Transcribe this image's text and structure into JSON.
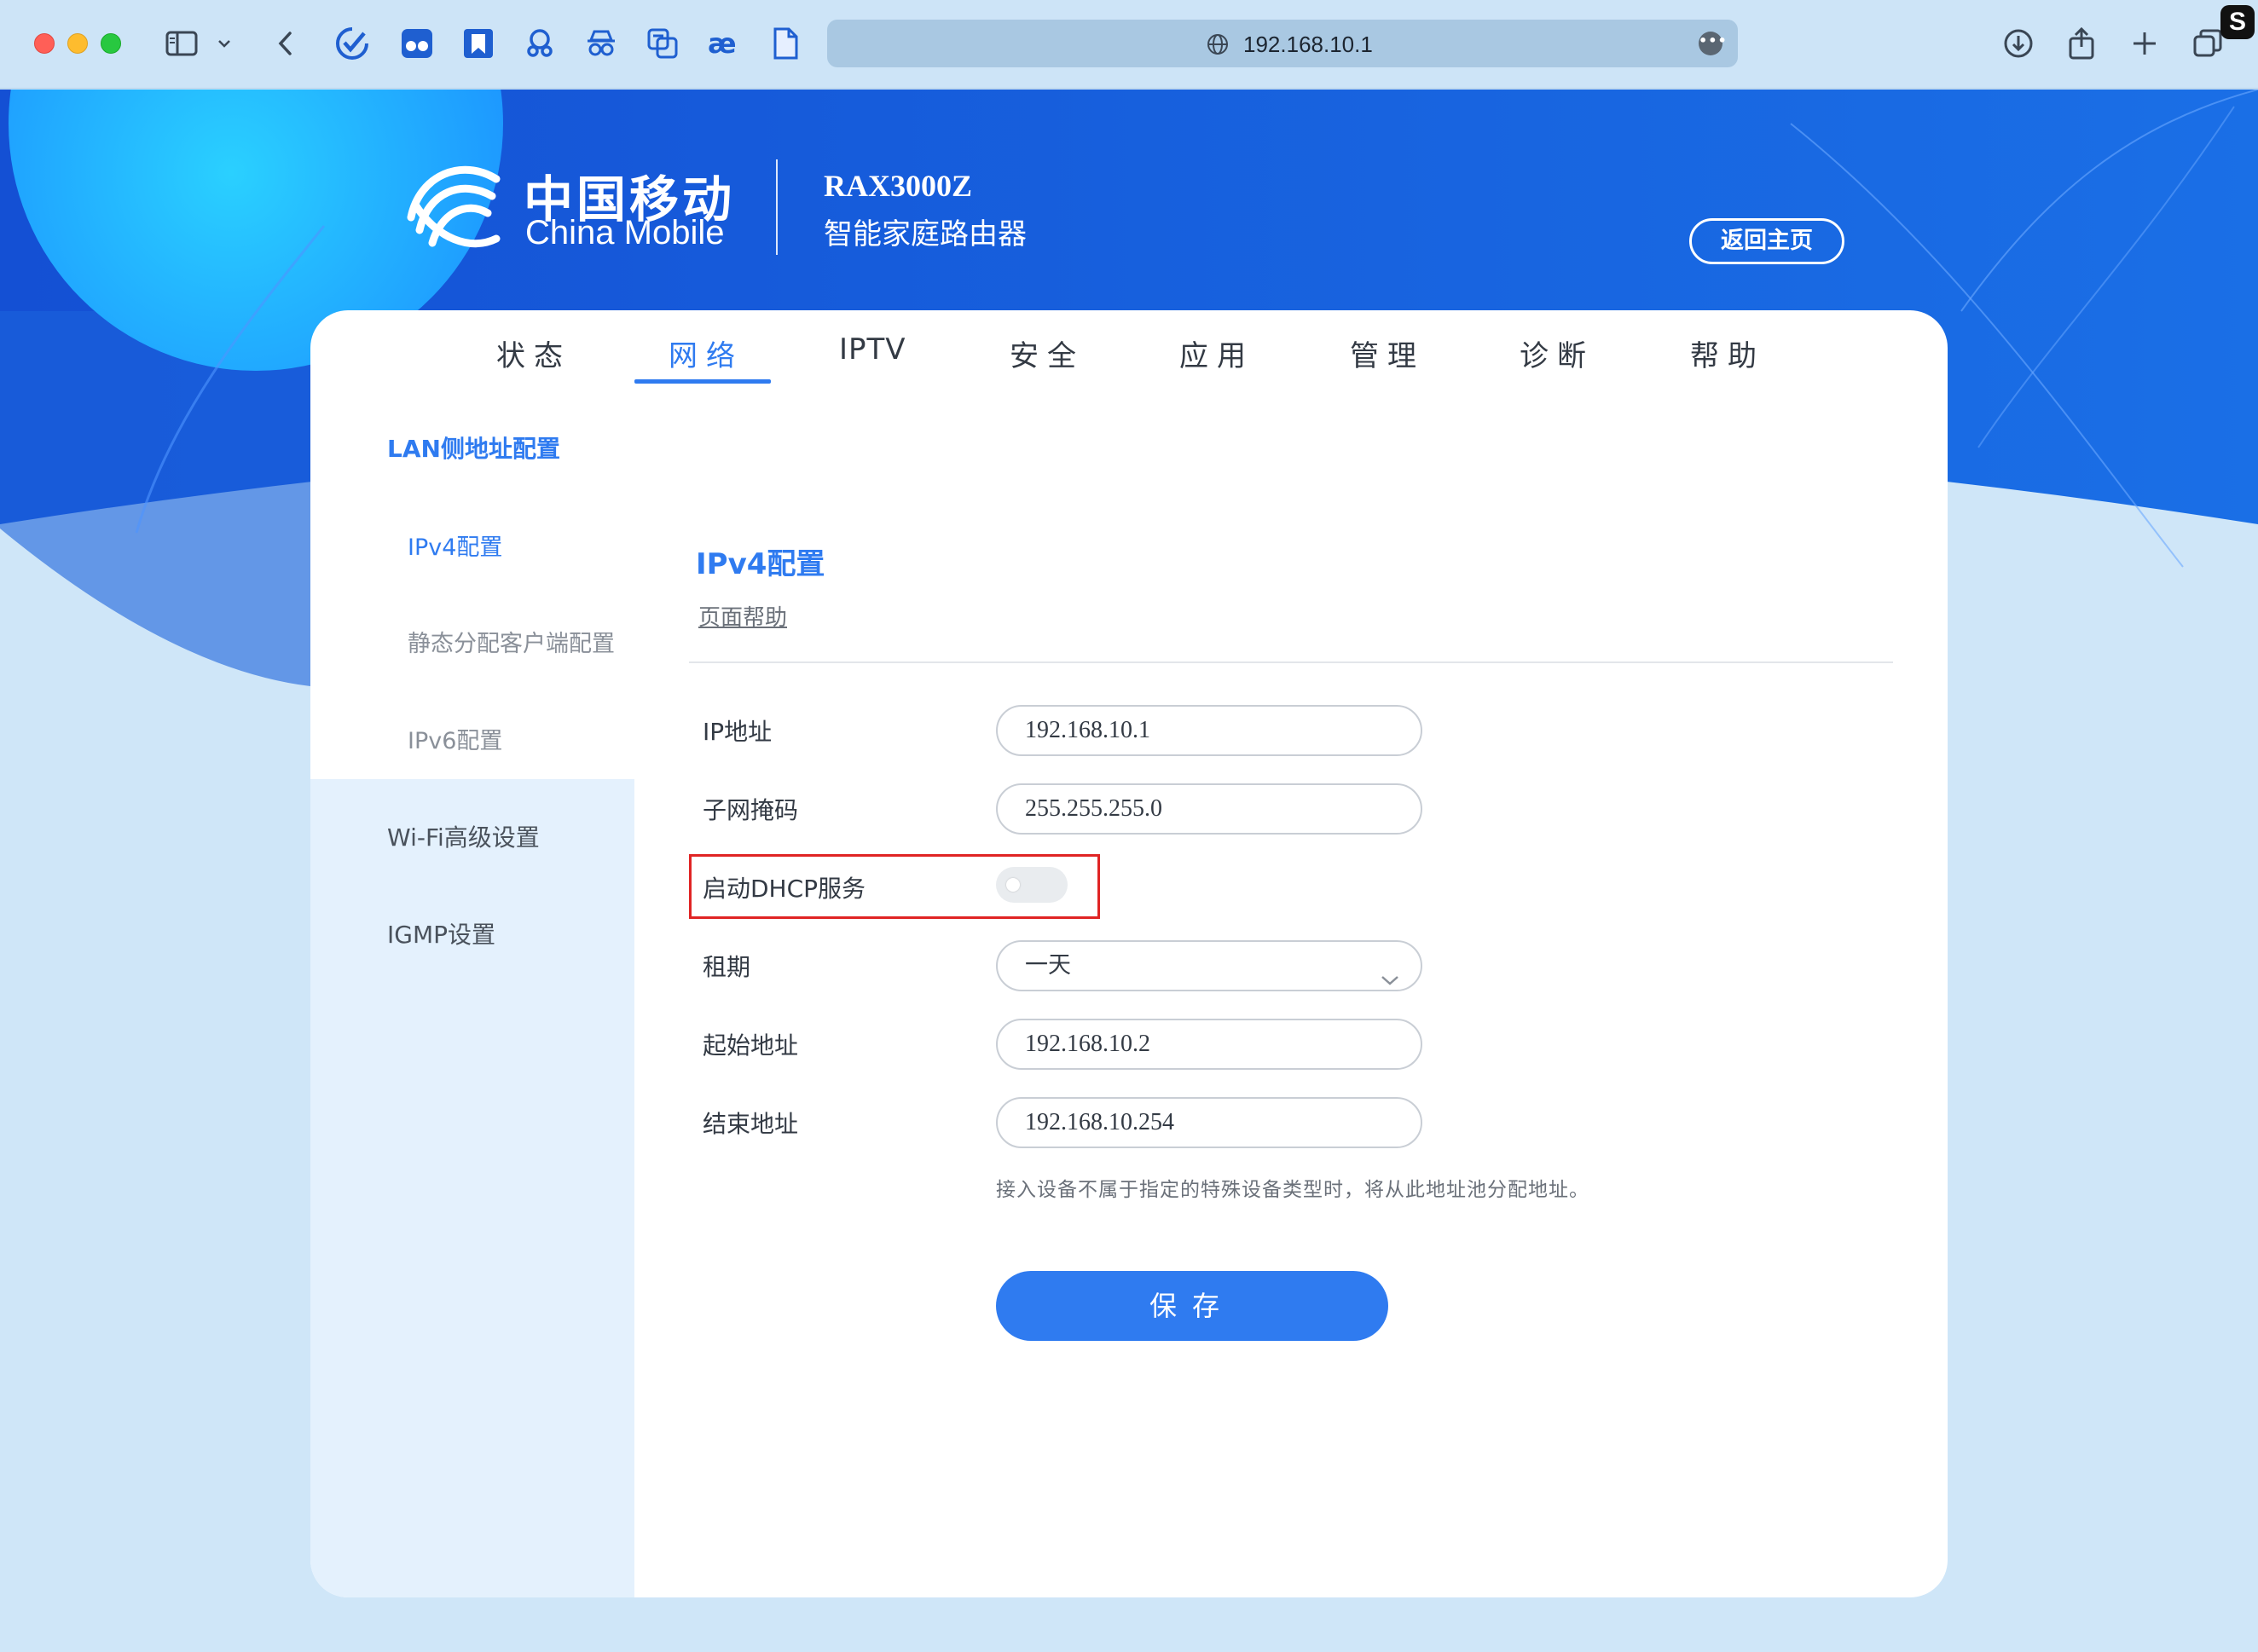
{
  "browser": {
    "url": "192.168.10.1",
    "more_label": "•••",
    "corner_badge": "S"
  },
  "header": {
    "brand_cn": "中国移动",
    "brand_en": "China Mobile",
    "model": "RAX3000Z",
    "model_desc": "智能家庭路由器",
    "home_button": "返回主页"
  },
  "nav": {
    "items": [
      {
        "label": "状态"
      },
      {
        "label": "网络"
      },
      {
        "label": "IPTV"
      },
      {
        "label": "安全"
      },
      {
        "label": "应用"
      },
      {
        "label": "管理"
      },
      {
        "label": "诊断"
      },
      {
        "label": "帮助"
      }
    ],
    "active": "网络"
  },
  "sidebar": {
    "group_title": "LAN侧地址配置",
    "sub_items": [
      {
        "label": "IPv4配置"
      },
      {
        "label": "静态分配客户端配置"
      },
      {
        "label": "IPv6配置"
      }
    ],
    "items": [
      {
        "label": "Wi-Fi高级设置"
      },
      {
        "label": "IGMP设置"
      }
    ]
  },
  "content": {
    "title": "IPv4配置",
    "help_link": "页面帮助",
    "form": {
      "ip_label": "IP地址",
      "ip_value": "192.168.10.1",
      "mask_label": "子网掩码",
      "mask_value": "255.255.255.0",
      "dhcp_label": "启动DHCP服务",
      "dhcp_enabled": false,
      "lease_label": "租期",
      "lease_value": "一天",
      "start_label": "起始地址",
      "start_value": "192.168.10.2",
      "end_label": "结束地址",
      "end_value": "192.168.10.254",
      "hint": "接入设备不属于指定的特殊设备类型时，将从此地址池分配地址。",
      "save_button": "保存"
    }
  },
  "colors": {
    "accent": "#2f7bf0",
    "header_bg": "#1565e0",
    "highlight": "#e02424"
  }
}
